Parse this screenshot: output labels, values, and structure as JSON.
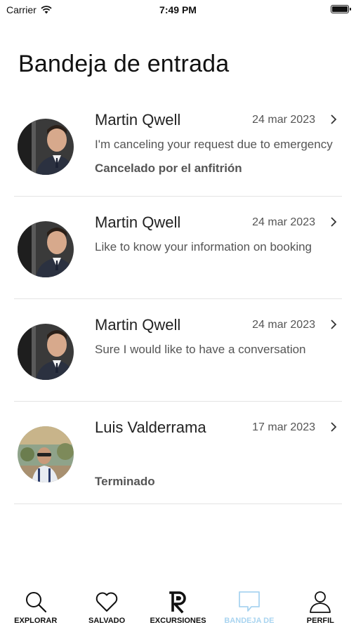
{
  "status_bar": {
    "carrier": "Carrier",
    "time": "7:49 PM",
    "battery_level": 0.9
  },
  "page": {
    "title": "Bandeja de entrada"
  },
  "messages": [
    {
      "name": "Martin Qwell",
      "date": "24 mar 2023",
      "snippet": "I'm canceling your request due to emergency",
      "status": "Cancelado por el anfitrión"
    },
    {
      "name": "Martin Qwell",
      "date": "24 mar 2023",
      "snippet": "Like to know your information on booking",
      "status": ""
    },
    {
      "name": "Martin Qwell",
      "date": "24 mar 2023",
      "snippet": "Sure I would like to have a conversation",
      "status": ""
    },
    {
      "name": "Luis Valderrama",
      "date": "17 mar 2023",
      "snippet": "",
      "status": "Terminado"
    }
  ],
  "tabs": [
    {
      "label": "EXPLORAR",
      "icon": "search-icon"
    },
    {
      "label": "SALVADO",
      "icon": "heart-icon"
    },
    {
      "label": "EXCURSIONES",
      "icon": "logo-icon"
    },
    {
      "label": "BANDEJA DE",
      "icon": "chat-bubble-icon",
      "active": true
    },
    {
      "label": "PERFIL",
      "icon": "person-icon"
    }
  ],
  "colors": {
    "active_tab": "#a9d4f0",
    "divider": "#e4e4e4"
  }
}
